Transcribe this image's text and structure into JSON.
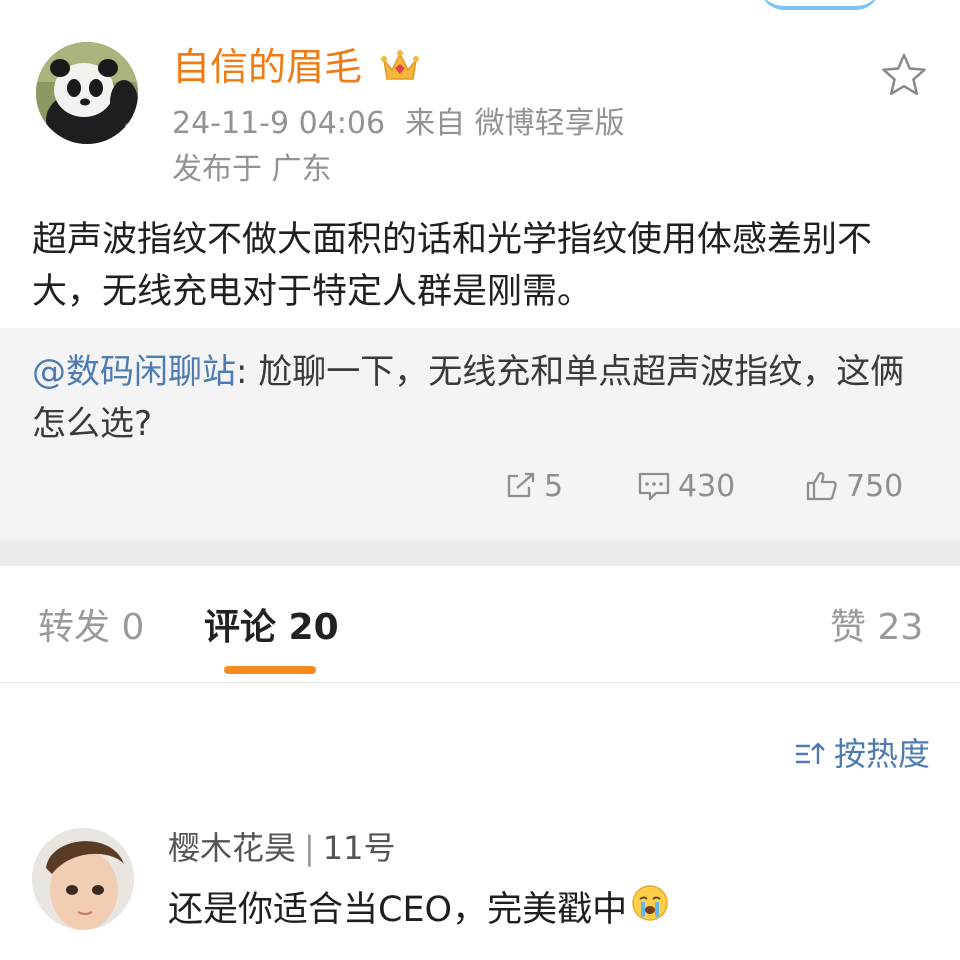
{
  "post": {
    "author": "自信的眉毛",
    "time": "24-11-9 04:06",
    "source": "来自 微博轻享版",
    "location": "发布于 广东",
    "text": "超声波指纹不做大面积的话和光学指纹使用体感差别不大，无线充电对于特定人群是刚需。",
    "icons": {
      "crown": "crown-icon",
      "favorite": "star-icon"
    }
  },
  "retweet": {
    "mention": "@数码闲聊站",
    "text": ": 尬聊一下，无线充和单点超声波指纹，这俩怎么选?",
    "reposts": "5",
    "comments": "430",
    "likes": "750"
  },
  "tabs": {
    "repost": "转发 0",
    "comment": "评论 20",
    "like": "赞 23"
  },
  "sort": {
    "label": "按热度"
  },
  "comments": [
    {
      "user": "樱木花昊",
      "floor": "11号",
      "text": "还是你适合当CEO，完美戳中"
    }
  ],
  "colors": {
    "accent_orange": "#f07b12",
    "link_blue": "#4e7cb2",
    "tab_indicator": "#f58a1f"
  }
}
